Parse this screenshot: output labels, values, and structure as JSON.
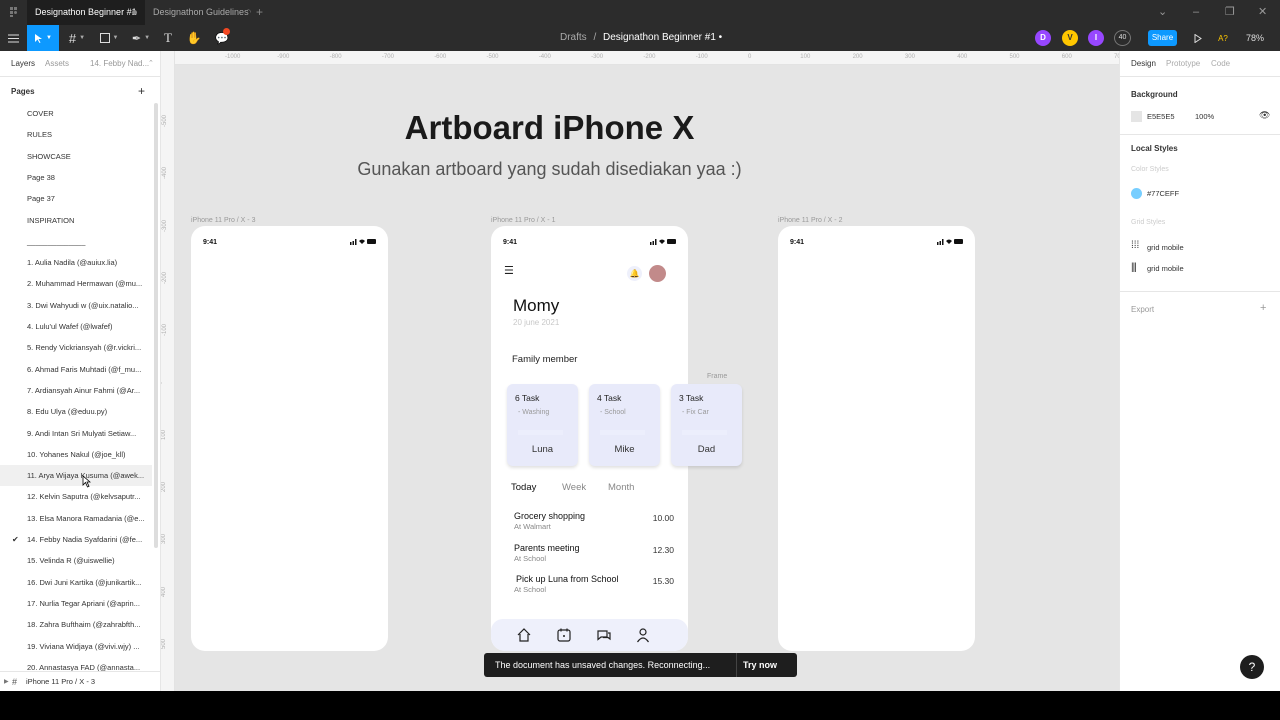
{
  "tabs": {
    "active": "Designathon Beginner #1",
    "second": "Designathon Guidelines"
  },
  "toolbar": {
    "breadcrumb_parent": "Drafts",
    "breadcrumb_sep": "/",
    "breadcrumb_current": "Designathon Beginner #1",
    "share_label": "Share",
    "zoom": "78%",
    "viewer_count": "40",
    "avatars": [
      {
        "letter": "D",
        "color": "#9747ff"
      },
      {
        "letter": "V",
        "color": "#ffc700"
      },
      {
        "letter": "I",
        "color": "#9747ff"
      }
    ],
    "prototype_letter": "A?",
    "accent": "#0d99ff"
  },
  "left_panel": {
    "tabs": [
      "Layers",
      "Assets",
      "14. Febby Nad..."
    ],
    "pages_heading": "Pages",
    "pages": [
      "COVER",
      "RULES",
      "SHOWCASE",
      "Page 38",
      "Page 37",
      "INSPIRATION",
      "______________",
      "1. Aulia Nadila (@auiux.lia)",
      "2. Muhammad Hermawan (@mu...",
      "3. Dwi Wahyudi w (@uix.natalio...",
      "4. Lulu'ul Wafef (@lwafef)",
      "5. Rendy Vickriansyah (@r.vickri...",
      "6. Ahmad Faris Muhtadi (@f_mu...",
      "7. Ardiansyah Ainur Fahmi (@Ar...",
      "8. Edu Ulya (@eduu.py)",
      "9. Andi Intan Sri Mulyati Setiaw...",
      "10. Yohanes Nakul (@joe_kll)",
      "11. Arya Wijaya Kusuma (@awek...",
      "12. Kelvin Saputra (@kelvsaputr...",
      "13. Elsa Manora Ramadania (@e...",
      "14. Febby Nadia Syafdarini (@fe...",
      "15. Velinda R (@uiswellie)",
      "16. Dwi Juni Kartika (@junikartik...",
      "17. Nurlia Tegar Apriani (@aprin...",
      "18. Zahra Bufthaim (@zahrabfth...",
      "19. Viviana Widjaya (@vivi.wjy) ...",
      "20. Annastasya FAD (@annasta..."
    ],
    "selected_page": "14. Febby Nadia Syafdarini (@fe...",
    "hovered_page": "11. Arya Wijaya Kusuma (@awek...",
    "bottom_layer": "iPhone 11 Pro / X - 3"
  },
  "canvas": {
    "background": "#e5e5e5",
    "ruler_top": [
      "-1000",
      "-900",
      "-800",
      "-700",
      "-600",
      "-500",
      "-400",
      "-300",
      "-200",
      "-100",
      "0",
      "100",
      "200",
      "300",
      "400",
      "500",
      "600",
      "700"
    ],
    "ruler_left": [
      "-500",
      "-400",
      "-300",
      "-200",
      "-100",
      "0",
      "100",
      "200",
      "300",
      "400",
      "500"
    ],
    "title": "Artboard iPhone X",
    "subtitle": "Gunakan artboard yang sudah disediakan yaa :)",
    "frames": [
      {
        "label": "iPhone 11 Pro / X - 3",
        "time": "9:41"
      },
      {
        "label": "iPhone 11 Pro / X - 1",
        "time": "9:41"
      },
      {
        "label": "iPhone 11 Pro / X - 2",
        "time": "9:41"
      }
    ],
    "frame_tag": "Frame"
  },
  "app": {
    "name": "Momy",
    "date": "20 june 2021",
    "family_heading": "Family member",
    "members": [
      {
        "task": "6 Task",
        "sub": "- Washing",
        "name": "Luna"
      },
      {
        "task": "4 Task",
        "sub": "- School",
        "name": "Mike"
      },
      {
        "task": "3 Task",
        "sub": "- Fix Car",
        "name": "Dad"
      }
    ],
    "period_tabs": [
      "Today",
      "Week",
      "Month"
    ],
    "tasks": [
      {
        "title": "Grocery shopping",
        "place": "At Walmart",
        "time": "10.00"
      },
      {
        "title": "Parents meeting",
        "place": "At School",
        "time": "12.30"
      },
      {
        "title": "Pick up Luna from School",
        "place": "At School",
        "time": "15.30"
      }
    ],
    "card_color": "#e8eafa"
  },
  "toast": {
    "message": "The document has unsaved changes. Reconnecting...",
    "action": "Try now"
  },
  "right_panel": {
    "tabs": [
      "Design",
      "Prototype",
      "Code"
    ],
    "background_heading": "Background",
    "background_hex": "E5E5E5",
    "background_opacity": "100%",
    "local_styles_heading": "Local Styles",
    "color_styles_label": "Color Styles",
    "color_style_value": "#77CEFF",
    "color_style_swatch": "#77ceff",
    "grid_styles_label": "Grid Styles",
    "grid_styles": [
      "grid mobile",
      "grid mobile"
    ],
    "export_heading": "Export"
  }
}
